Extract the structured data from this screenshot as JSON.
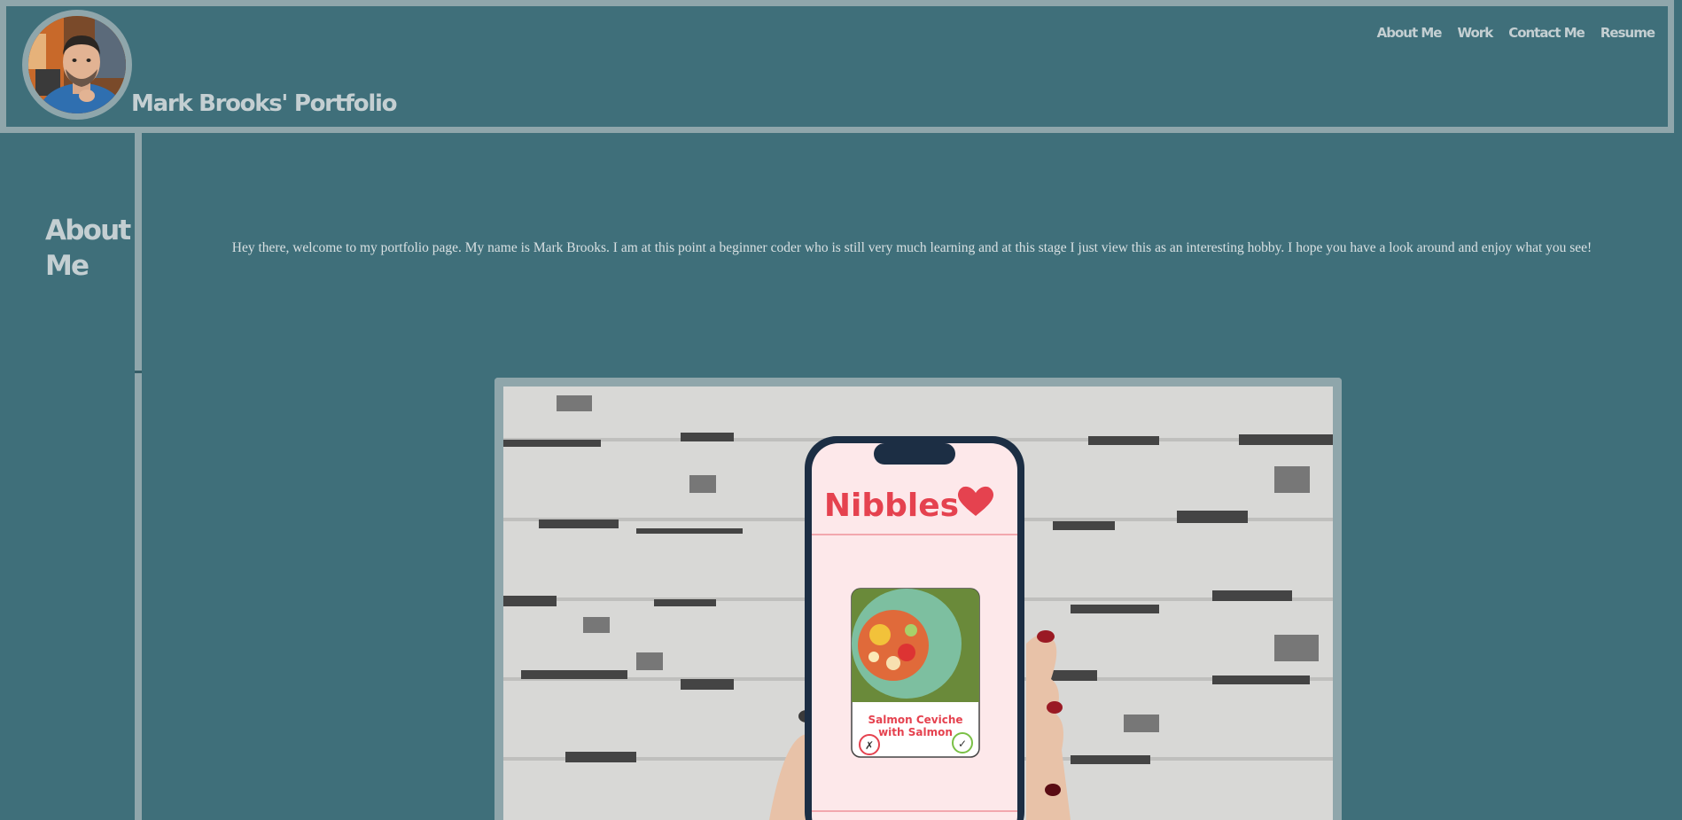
{
  "header": {
    "title": "Mark Brooks' Portfolio",
    "avatar_alt": "Mark Brooks profile photo"
  },
  "nav": {
    "items": [
      "About Me",
      "Work",
      "Contact Me",
      "Resume"
    ]
  },
  "about": {
    "heading": "About Me",
    "intro": "Hey there, welcome to my portfolio page. My name is Mark Brooks. I am at this point a beginner coder who is still very much learning and at this stage I just view this as an interesting hobby. I hope you have a look around and enjoy what you see!"
  },
  "project": {
    "app_name": "Nibbles",
    "card_title_line1": "Salmon Ceviche",
    "card_title_line2": "with Salmon",
    "reject_symbol": "✗",
    "accept_symbol": "✓"
  },
  "colors": {
    "background": "#3f6f7a",
    "border": "#8fa6ab",
    "text_light": "#c4cfd2",
    "brand_red": "#e5424f"
  }
}
